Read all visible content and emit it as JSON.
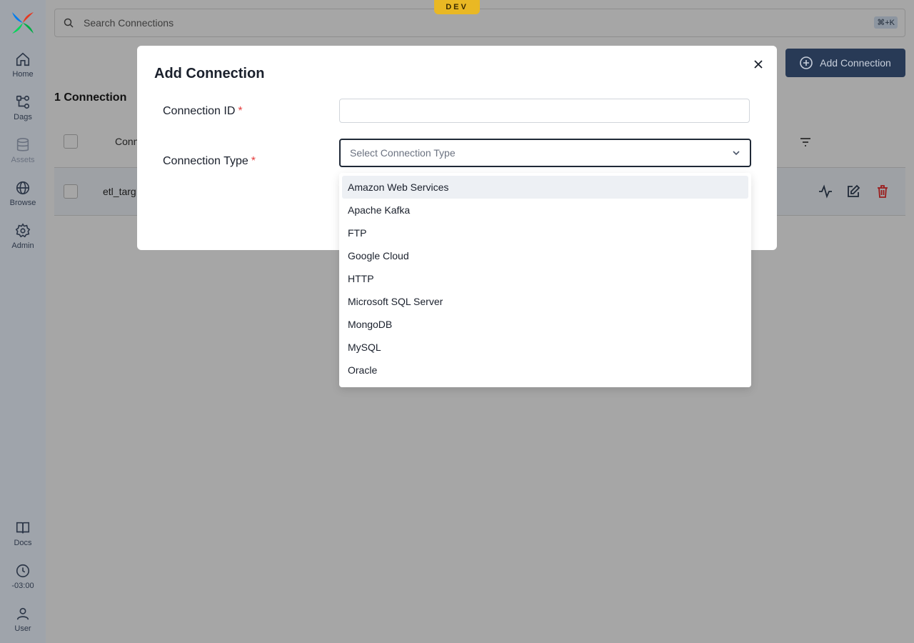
{
  "env_badge": "DEV",
  "search": {
    "placeholder": "Search Connections",
    "shortcut": "⌘+K"
  },
  "sidebar": {
    "items": [
      {
        "label": "Home",
        "icon": "home-icon"
      },
      {
        "label": "Dags",
        "icon": "dags-icon"
      },
      {
        "label": "Assets",
        "icon": "database-icon"
      },
      {
        "label": "Browse",
        "icon": "globe-icon"
      },
      {
        "label": "Admin",
        "icon": "gear-icon"
      }
    ],
    "bottom_items": [
      {
        "label": "Docs",
        "icon": "book-icon"
      },
      {
        "label": "-03:00",
        "icon": "clock-icon"
      },
      {
        "label": "User",
        "icon": "user-icon"
      }
    ]
  },
  "page": {
    "add_button_label": "Add Connection",
    "count_title": "1 Connection",
    "column_header_partial": "Conn",
    "row_text_partial": "etl_targ"
  },
  "modal": {
    "title": "Add Connection",
    "connection_id_label": "Connection ID",
    "connection_id_value": "",
    "connection_type_label": "Connection Type",
    "required_mark": "*",
    "select_placeholder": "Select Connection Type",
    "options": [
      "Amazon Web Services",
      "Apache Kafka",
      "FTP",
      "Google Cloud",
      "HTTP",
      "Microsoft SQL Server",
      "MongoDB",
      "MySQL",
      "Oracle"
    ],
    "highlighted_option": "Amazon Web Services"
  },
  "colors": {
    "accent": "#283a56",
    "required": "#e53e3e",
    "delete": "#9b1c1c",
    "env_badge": "#e9b824"
  }
}
